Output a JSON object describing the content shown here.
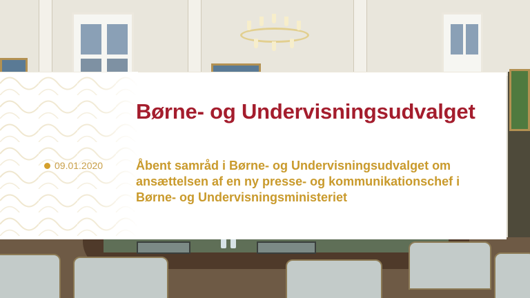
{
  "card": {
    "title": "Børne- og Undervisningsudvalget",
    "date": "09.01.2020",
    "description": "Åbent samråd i Børne- og Undervisningsudvalget om ansættelsen af en ny presse- og kommunikationschef i Børne- og Undervisningsministeriet"
  },
  "colors": {
    "title": "#a41d2d",
    "description": "#c99a2c",
    "dot": "#d4a02c",
    "card_background": "#ffffff"
  }
}
